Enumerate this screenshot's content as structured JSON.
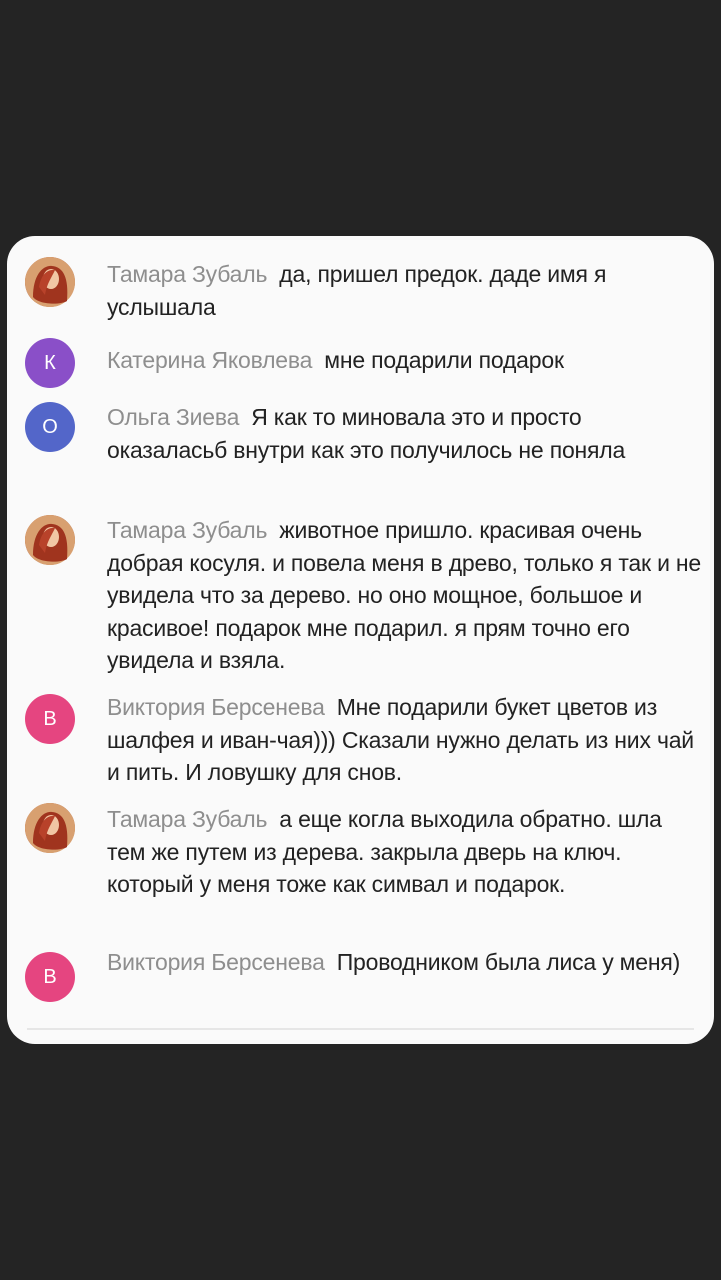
{
  "comments": [
    {
      "avatar_type": "photo",
      "avatar_letter": "",
      "avatar_color": "",
      "author": "Тамара Зубаль",
      "text": "да, пришел предок. даде имя я услышала"
    },
    {
      "avatar_type": "letter",
      "avatar_letter": "К",
      "avatar_color": "#8a4fc8",
      "author": "Катерина Яковлева",
      "text": "мне подарили подарок"
    },
    {
      "avatar_type": "letter",
      "avatar_letter": "О",
      "avatar_color": "#5366c9",
      "author": "Ольга Зиева",
      "text": "Я как то миновала это и просто оказаласьб внутри как это получилось не поняла"
    },
    {
      "avatar_type": "photo",
      "avatar_letter": "",
      "avatar_color": "",
      "author": "Тамара Зубаль",
      "text": "животное пришло. красивая очень добрая косуля. и повела меня в древо, только я так и не увидела что за дерево. но оно мощное, большое и красивое! подарок мне подарил. я прям точно его увидела и взяла."
    },
    {
      "avatar_type": "letter",
      "avatar_letter": "В",
      "avatar_color": "#e54580",
      "author": "Виктория Берсенева",
      "text": "Мне подарили букет цветов из шалфея и иван-чая))) Сказали нужно делать из них чай и пить. И ловушку для снов."
    },
    {
      "avatar_type": "photo",
      "avatar_letter": "",
      "avatar_color": "",
      "author": "Тамара Зубаль",
      "text": "а еще когла выходила обратно. шла тем же путем из дерева. закрыла дверь на ключ. который у меня тоже как симвал и подарок."
    },
    {
      "avatar_type": "letter",
      "avatar_letter": "В",
      "avatar_color": "#e54580",
      "author": "Виктория Берсенева",
      "text": "Проводником была лиса у меня)"
    }
  ]
}
